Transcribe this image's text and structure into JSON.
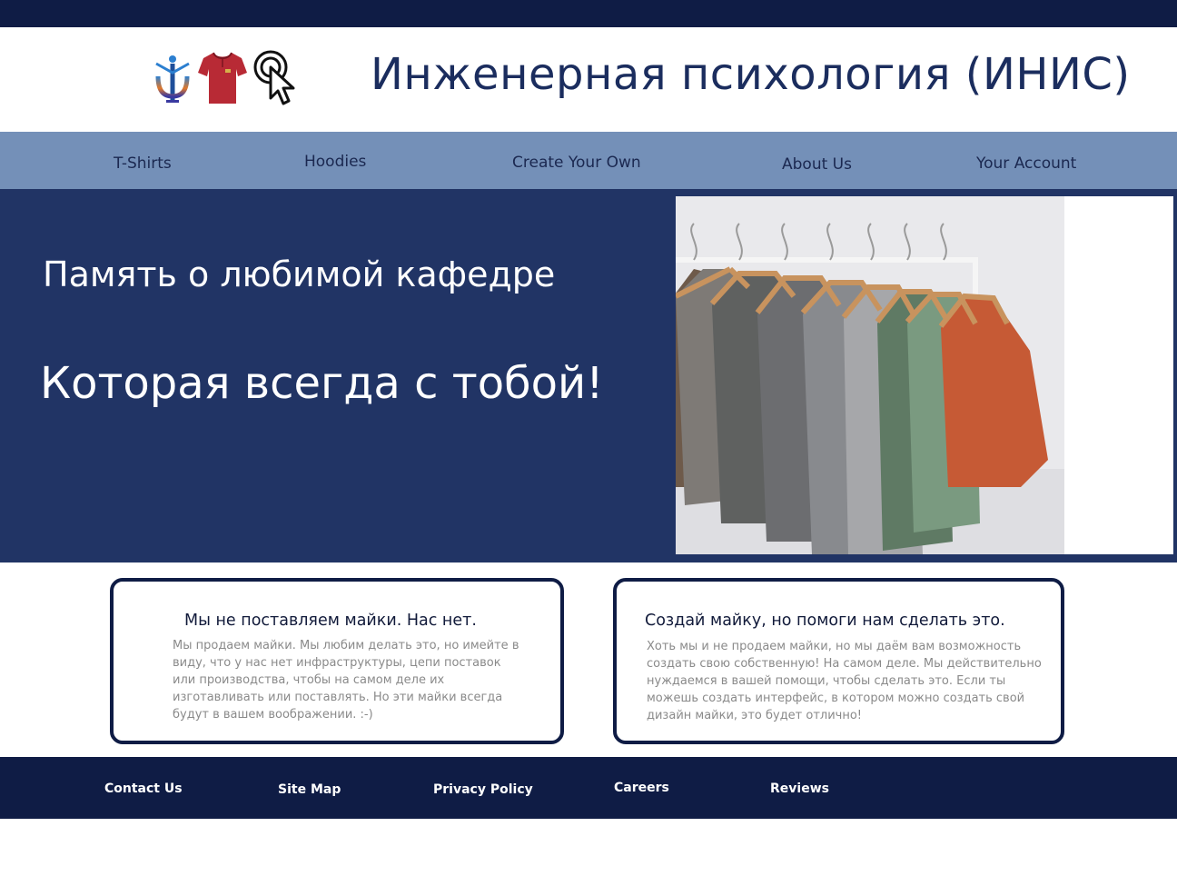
{
  "header": {
    "title": "Инженерная психология (ИНИС)",
    "logos": [
      "psi-logo-icon",
      "t-shirt-icon",
      "click-cursor-icon"
    ]
  },
  "nav": {
    "items": [
      {
        "label": "T-Shirts"
      },
      {
        "label": "Hoodies"
      },
      {
        "label": "Create Your Own"
      },
      {
        "label": "About Us"
      },
      {
        "label": "Your Account"
      }
    ]
  },
  "hero": {
    "line1": "Память о любимой кафедре",
    "line2": "Которая всегда с тобой!",
    "image": "clothing-rack-photo"
  },
  "cards": [
    {
      "title": "Мы не поставляем майки. Нас нет.",
      "body": "Мы продаем майки. Мы любим делать это, но имейте в виду, что у нас нет инфраструктуры, цепи поставок или производства, чтобы на самом деле их изготавливать или поставлять. Но эти майки всегда будут в вашем воображении. :-)"
    },
    {
      "title": "Создай майку, но помоги нам сделать это.",
      "body": "Хоть мы и не продаем майки, но мы даём вам возможность создать свою собственную! На самом деле. Мы действительно нуждаемся в вашей помощи, чтобы сделать это. Если ты можешь создать интерфейс, в котором можно создать свой дизайн майки, это будет отлично!"
    }
  ],
  "footer": {
    "links": [
      {
        "label": "Contact Us"
      },
      {
        "label": "Site Map"
      },
      {
        "label": "Privacy Policy"
      },
      {
        "label": "Careers"
      },
      {
        "label": "Reviews"
      }
    ]
  },
  "colors": {
    "dark_navy": "#0f1c45",
    "hero_blue": "#213465",
    "nav_blue": "#7490b8",
    "title_blue": "#1b2d5e"
  }
}
